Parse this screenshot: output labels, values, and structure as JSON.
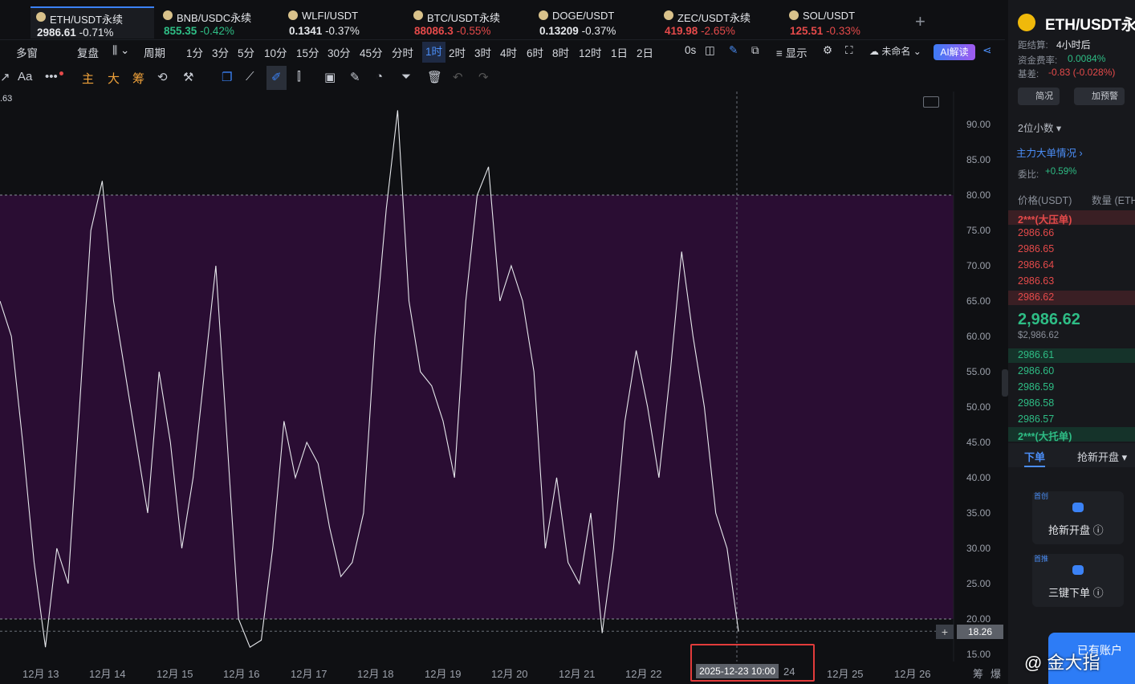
{
  "tickers": [
    {
      "name": "ETH/USDT永续",
      "price": "2986.61",
      "change": "-0.71%",
      "price_color": "wh",
      "change_color": "wh",
      "active": true
    },
    {
      "name": "BNB/USDC永续",
      "price": "855.35",
      "change": "-0.42%",
      "price_color": "up",
      "change_color": "up"
    },
    {
      "name": "WLFI/USDT",
      "price": "0.1341",
      "change": "-0.37%",
      "price_color": "wh",
      "change_color": "wh"
    },
    {
      "name": "BTC/USDT永续",
      "price": "88086.3",
      "change": "-0.55%",
      "price_color": "dn",
      "change_color": "dn"
    },
    {
      "name": "DOGE/USDT",
      "price": "0.13209",
      "change": "-0.37%",
      "price_color": "wh",
      "change_color": "wh"
    },
    {
      "name": "ZEC/USDT永续",
      "price": "419.98",
      "change": "-2.65%",
      "price_color": "dn",
      "change_color": "dn"
    },
    {
      "name": "SOL/USDT",
      "price": "125.51",
      "change": "-0.33%",
      "price_color": "dn",
      "change_color": "dn"
    }
  ],
  "toolbar": {
    "multi_window": "多窗",
    "replay": "复盘",
    "period": "周期",
    "intervals": [
      "1分",
      "3分",
      "5分",
      "10分",
      "15分",
      "30分",
      "45分",
      "分时",
      "1时",
      "2时",
      "3时",
      "4时",
      "6时",
      "8时",
      "12时",
      "1日",
      "2日"
    ],
    "selected_interval": "1时",
    "zero_s": "0s",
    "display": "显示",
    "unnamed": "未命名",
    "ai": "AI解读"
  },
  "drawbar": {
    "text_tool": "Aa",
    "more": "•••",
    "main": "主",
    "big": "大",
    "chips": "筹"
  },
  "chart": {
    "top_value": ".63",
    "y_labels": [
      "90.00",
      "85.00",
      "80.00",
      "75.00",
      "70.00",
      "65.00",
      "60.00",
      "55.00",
      "50.00",
      "45.00",
      "40.00",
      "35.00",
      "30.00",
      "25.00",
      "20.00",
      "15.00"
    ],
    "current_value": "18.26",
    "band_upper": 80,
    "band_lower": 20,
    "x_labels": [
      "12月 13",
      "12月 14",
      "12月 15",
      "12月 16",
      "12月 17",
      "12月 18",
      "12月 19",
      "12月 20",
      "12月 21",
      "12月 22",
      "24",
      "12月 25",
      "12月 26",
      "筹",
      "爆"
    ],
    "crosshair_time": "2025-12-23 10:00"
  },
  "chart_data": {
    "type": "line",
    "ylim": [
      15,
      90
    ],
    "x": [
      "12月 13",
      "12月 14",
      "12月 15",
      "12月 16",
      "12月 17",
      "12月 18",
      "12月 19",
      "12月 20",
      "12月 21",
      "12月 22",
      "12月 23"
    ],
    "values": [
      65,
      60,
      45,
      28,
      16,
      30,
      25,
      50,
      75,
      82,
      65,
      55,
      45,
      35,
      55,
      45,
      30,
      40,
      55,
      70,
      45,
      20,
      16,
      17,
      30,
      48,
      40,
      45,
      42,
      33,
      26,
      28,
      35,
      60,
      78,
      92,
      65,
      55,
      53,
      48,
      40,
      65,
      80,
      84,
      65,
      70,
      65,
      55,
      30,
      40,
      28,
      25,
      35,
      18,
      30,
      48,
      58,
      50,
      40,
      55,
      72,
      60,
      50,
      35,
      30,
      18.26
    ],
    "current": 18.26
  },
  "right_panel": {
    "title": "ETH/USDT永续",
    "funding_countdown_label": "距结算:",
    "funding_countdown": "4小时后",
    "funding_rate_label": "资金费率:",
    "funding_rate": "0.0084%",
    "basis_label": "基差:",
    "basis": "-0.83 (-0.028%)",
    "overview_btn": "简况",
    "alert_btn": "加预警",
    "decimals": "2位小数",
    "big_orders": "主力大单情况",
    "ratio_label": "委比:",
    "ratio": "+0.59%",
    "col_price": "价格(USDT)",
    "col_qty": "数量 (ETH",
    "ask_big": "2***(大压单)",
    "asks": [
      "2986.66",
      "2986.65",
      "2986.64",
      "2986.63",
      "2986.62"
    ],
    "mid_price": "2,986.62",
    "mid_sub": "$2,986.62",
    "bids": [
      "2986.61",
      "2986.60",
      "2986.59",
      "2986.58",
      "2986.57"
    ],
    "bid_big": "2***(大托单)",
    "tab_order": "下单",
    "tab_grab": "抢新开盘",
    "card1_badge": "首创",
    "card1_label": "抢新开盘",
    "card2_badge": "首推",
    "card2_label": "三键下单",
    "account_btn": "已有账户"
  },
  "watermark": "@ 金大指"
}
